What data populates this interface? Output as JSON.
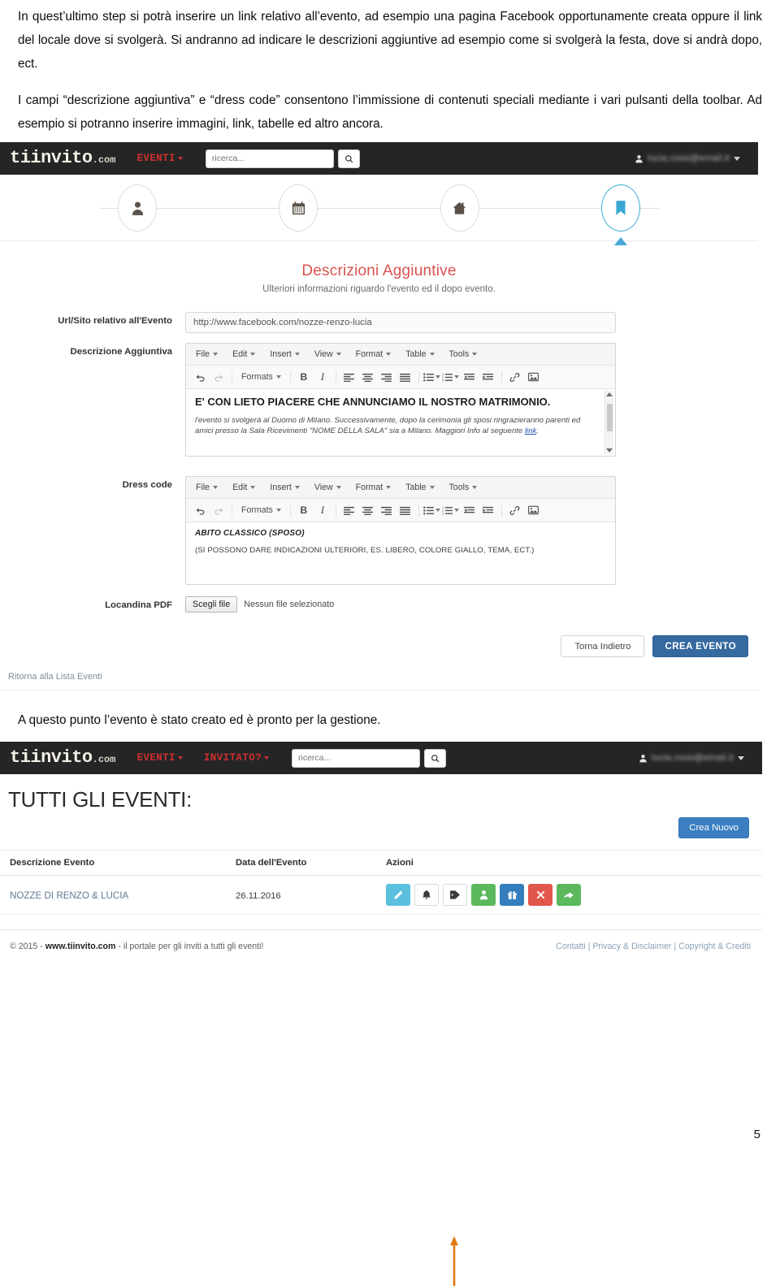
{
  "document": {
    "paragraphs": [
      "In quest’ultimo step si potrà inserire un link relativo all’evento, ad esempio una pagina Facebook opportunamente creata oppure il link del locale dove si svolgerà. Si andranno ad indicare le descrizioni aggiuntive ad esempio come si svolgerà la festa, dove si andrà dopo, ect.",
      "I campi “descrizione aggiuntiva” e “dress code” consentono l’immissione di contenuti speciali mediante i vari pulsanti della toolbar. Ad esempio si potranno inserire immagini, link, tabelle ed altro ancora."
    ],
    "caption_between": "A questo punto l’evento è stato creato ed è pronto per la gestione.",
    "page_number": "5"
  },
  "navbar": {
    "brand_main": "tiinvito",
    "brand_suffix": ".com",
    "links_shot1": [
      "EVENTI"
    ],
    "links_shot2": [
      "EVENTI",
      "INVITATO?"
    ],
    "search_placeholder": "ricerca...",
    "search_icon": "search-icon",
    "user_name": "lucia.rossi@email.it",
    "user_icon": "user-icon"
  },
  "stepper": {
    "steps": [
      {
        "icon": "person-icon",
        "active": false
      },
      {
        "icon": "calendar-icon",
        "active": false
      },
      {
        "icon": "home-icon",
        "active": false
      },
      {
        "icon": "bookmark-icon",
        "active": true
      }
    ],
    "active_color": "#3aaed8"
  },
  "form": {
    "title": "Descrizioni Aggiuntive",
    "subtitle": "Ulteriori informazioni riguardo l'evento ed il dopo evento.",
    "title_color": "#d9534f",
    "fields": {
      "url_label": "Url/Sito relativo all'Evento",
      "url_value": "http://www.facebook.com/nozze-renzo-lucia",
      "desc_label": "Descrizione Aggiuntiva",
      "dress_label": "Dress code",
      "pdf_label": "Locandina PDF",
      "pdf_button": "Scegli file",
      "pdf_status": "Nessun file selezionato"
    },
    "buttons": {
      "back": "Torna Indietro",
      "create": "CREA EVENTO",
      "create_color": "#35699f"
    },
    "back_link": "Ritorna alla Lista Eventi"
  },
  "editor": {
    "menubar": [
      "File",
      "Edit",
      "Insert",
      "View",
      "Format",
      "Table",
      "Tools"
    ],
    "toolbar": [
      "undo-icon",
      "redo-icon",
      "formats-dropdown",
      "bold-icon",
      "italic-icon",
      "align-left-icon",
      "align-center-icon",
      "align-right-icon",
      "align-justify-icon",
      "bullet-list-icon",
      "numbered-list-icon",
      "outdent-icon",
      "indent-icon",
      "link-icon",
      "image-icon"
    ],
    "formats_label": "Formats",
    "bold_label": "B",
    "italic_label": "I",
    "description_content": {
      "heading": "E' CON LIETO PIACERE CHE ANNUNCIAMO IL NOSTRO MATRIMONIO.",
      "body_before_link": "l'evento si svolgerà al Duomo di Milano. Successivamente, dopo la cerimonia gli sposi ringrazieranno parenti ed amici presso la Sala Ricevimenti \"NOME DELLA SALA\" sia a Milano. Maggiori Info al seguente ",
      "link_text": "link",
      "body_after_link": "."
    },
    "dress_content": {
      "heading": "ABITO CLASSICO (SPOSO)",
      "body": "(SI POSSONO DARE INDICAZIONI ULTERIORI, ES. LIBERO, COLORE GIALLO, TEMA, ECT.)"
    }
  },
  "events_page": {
    "heading": "TUTTI GLI EVENTI:",
    "create_button": "Crea Nuovo",
    "create_button_color": "#3c7fc1",
    "columns": [
      "Descrizione Evento",
      "Data dell'Evento",
      "Azioni"
    ],
    "rows": [
      {
        "description": "NOZZE DI RENZO & LUCIA",
        "date": "26.11.2016",
        "actions": [
          {
            "icon": "pencil-icon",
            "color": "#5bc0de"
          },
          {
            "icon": "bell-icon",
            "color": "#ffffff"
          },
          {
            "icon": "tag-icon",
            "color": "#ffffff"
          },
          {
            "icon": "person-icon",
            "color": "#5cb85c"
          },
          {
            "icon": "gift-icon",
            "color": "#357ebd"
          },
          {
            "icon": "close-x-icon",
            "color": "#e2574c"
          },
          {
            "icon": "share-arrow-icon",
            "color": "#5cb85c"
          }
        ]
      }
    ]
  },
  "footer": {
    "copyright_prefix": "© 2015 - ",
    "site": "www.tiinvito.com",
    "copyright_suffix": " - il portale per gli inviti a tutti gli eventi!",
    "links": [
      "Contatti",
      "Privacy & Disclaimer",
      "Copyright & Crediti"
    ]
  }
}
